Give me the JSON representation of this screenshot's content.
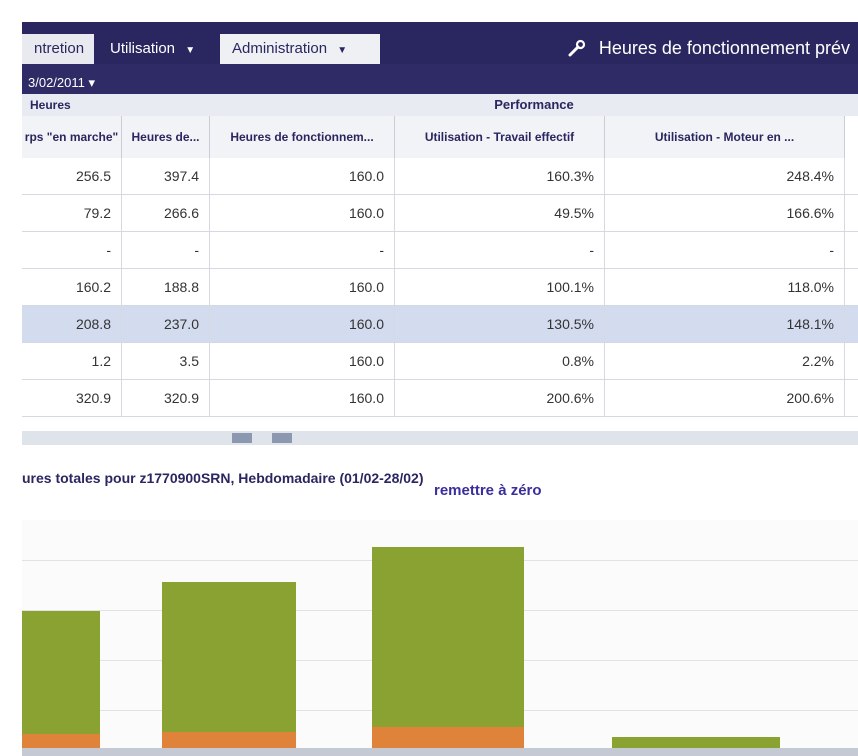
{
  "tabs": [
    {
      "label": "ntretion",
      "state": "inactive"
    },
    {
      "label": "Utilisation",
      "state": "active"
    },
    {
      "label": "Administration",
      "state": "inactive"
    }
  ],
  "date_label": "3/02/2011 ▾",
  "page_title": "Heures de fonctionnement prév",
  "group_headers": {
    "heures": "Heures",
    "performance": "Performance"
  },
  "columns": [
    "rps \"en marche\"",
    "Heures de...",
    "Heures de fonctionnem...",
    "Utilisation - Travail effectif",
    "Utilisation - Moteur en ..."
  ],
  "rows": [
    {
      "c1": "256.5",
      "c2": "397.4",
      "c3": "160.0",
      "c4": "160.3%",
      "c5": "248.4%",
      "selected": false
    },
    {
      "c1": "79.2",
      "c2": "266.6",
      "c3": "160.0",
      "c4": "49.5%",
      "c5": "166.6%",
      "selected": false
    },
    {
      "c1": "-",
      "c2": "-",
      "c3": "-",
      "c4": "-",
      "c5": "-",
      "selected": false
    },
    {
      "c1": "160.2",
      "c2": "188.8",
      "c3": "160.0",
      "c4": "100.1%",
      "c5": "118.0%",
      "selected": false
    },
    {
      "c1": "208.8",
      "c2": "237.0",
      "c3": "160.0",
      "c4": "130.5%",
      "c5": "148.1%",
      "selected": true
    },
    {
      "c1": "1.2",
      "c2": "3.5",
      "c3": "160.0",
      "c4": "0.8%",
      "c5": "2.2%",
      "selected": false
    },
    {
      "c1": "320.9",
      "c2": "320.9",
      "c3": "160.0",
      "c4": "200.6%",
      "c5": "200.6%",
      "selected": false
    }
  ],
  "chart_header": "ures totales pour z1770900SRN, Hebdomadaire (01/02-28/02)",
  "reset_label": "remettre à zéro",
  "chart_data": {
    "type": "bar",
    "series_colors": [
      "#8aa232",
      "#e0833a"
    ],
    "bars": [
      {
        "main": 0.6,
        "sub": 0.06
      },
      {
        "main": 0.73,
        "sub": 0.07
      },
      {
        "main": 0.88,
        "sub": 0.09
      },
      {
        "main": 0.05,
        "sub": 0.0
      }
    ]
  },
  "colors": {
    "nav": "#2a2660",
    "selected_row": "#d3dcef",
    "bar_green": "#8aa232",
    "bar_orange": "#e0833a",
    "link": "#3a2e9c"
  }
}
